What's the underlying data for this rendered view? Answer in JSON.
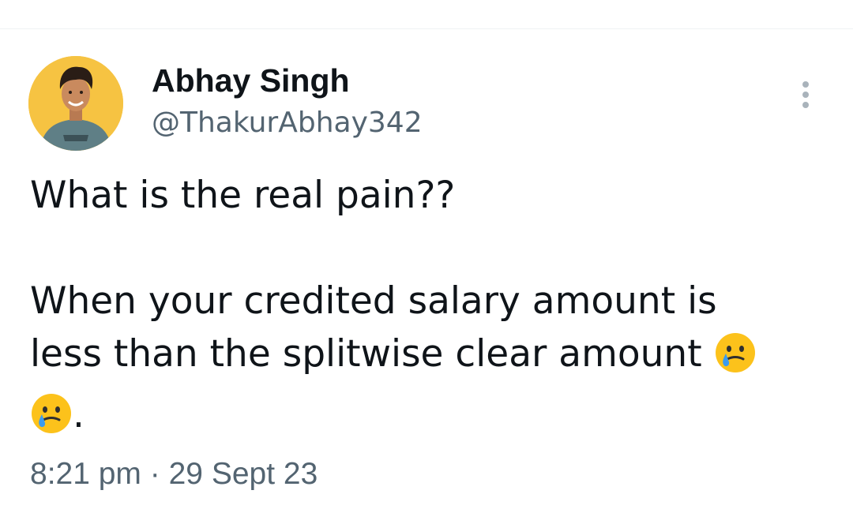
{
  "author": {
    "display_name": "Abhay Singh",
    "handle": "@ThakurAbhay342"
  },
  "tweet": {
    "line1": "What is the real pain??",
    "line2": "When your credited salary amount is",
    "line3": "less than the splitwise clear amount",
    "line4_suffix": ".",
    "emoji_icon": "face-holding-back-tears-icon"
  },
  "meta": {
    "time": "8:21 pm",
    "separator": "·",
    "date": "29 Sept 23"
  },
  "colors": {
    "primary_text": "#0f1419",
    "secondary_text": "#536471",
    "avatar_bg": "#f6c342",
    "emoji_face": "#fcc21b",
    "emoji_tear": "#3b9bef"
  }
}
